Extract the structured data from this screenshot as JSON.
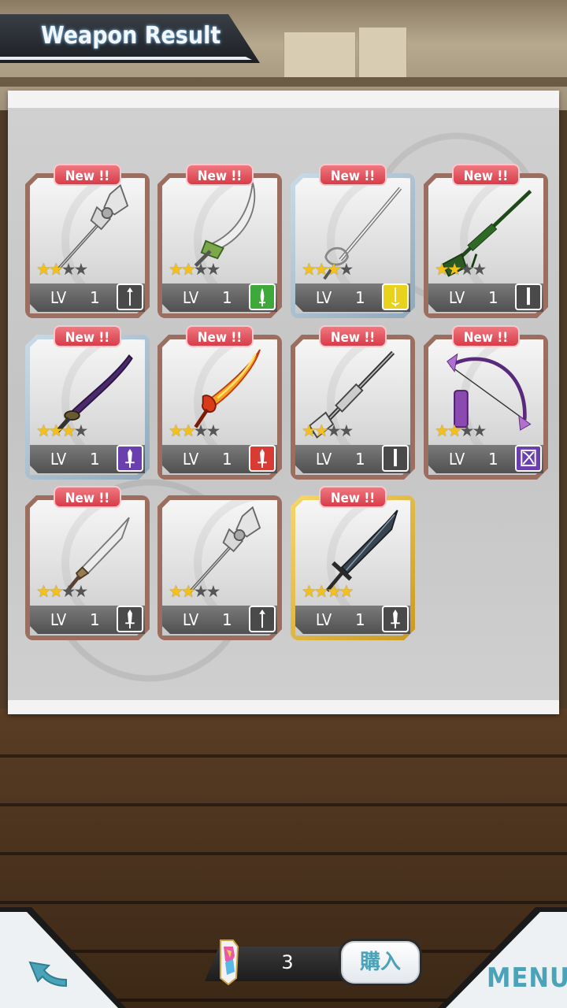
{
  "header": {
    "title": "Weapon Result"
  },
  "weapons": [
    {
      "badge": "New !!",
      "stars": 2,
      "lv_label": "LV",
      "level": "1",
      "frame": "bronze",
      "type": "spear",
      "type_color": "#4a4a4a",
      "art": "halberd-silver"
    },
    {
      "badge": "New !!",
      "stars": 2,
      "lv_label": "LV",
      "level": "1",
      "frame": "bronze",
      "type": "dagger",
      "type_color": "#3fa83a",
      "art": "scimitar-green"
    },
    {
      "badge": "New !!",
      "stars": 3,
      "lv_label": "LV",
      "level": "1",
      "frame": "silver",
      "type": "rapier",
      "type_color": "#e8d21e",
      "art": "rapier-silver"
    },
    {
      "badge": "New !!",
      "stars": 2,
      "lv_label": "LV",
      "level": "1",
      "frame": "bronze",
      "type": "gun",
      "type_color": "#4a4a4a",
      "art": "sniper-green"
    },
    {
      "badge": "New !!",
      "stars": 3,
      "lv_label": "LV",
      "level": "1",
      "frame": "silver",
      "type": "sword",
      "type_color": "#6a3fae",
      "art": "katana-purple"
    },
    {
      "badge": "New !!",
      "stars": 2,
      "lv_label": "LV",
      "level": "1",
      "frame": "bronze",
      "type": "sword",
      "type_color": "#d83a34",
      "art": "flame-sword"
    },
    {
      "badge": "New !!",
      "stars": 2,
      "lv_label": "LV",
      "level": "1",
      "frame": "bronze",
      "type": "gun",
      "type_color": "#4a4a4a",
      "art": "sniper-silver"
    },
    {
      "badge": "New !!",
      "stars": 2,
      "lv_label": "LV",
      "level": "1",
      "frame": "bronze",
      "type": "bow",
      "type_color": "#6a3fae",
      "art": "bow-purple"
    },
    {
      "badge": "New !!",
      "stars": 2,
      "lv_label": "LV",
      "level": "1",
      "frame": "bronze",
      "type": "sword",
      "type_color": "#4a4a4a",
      "art": "blade-silver"
    },
    {
      "badge": "",
      "stars": 2,
      "lv_label": "LV",
      "level": "1",
      "frame": "bronze",
      "type": "spear",
      "type_color": "#4a4a4a",
      "art": "halberd-silver"
    },
    {
      "badge": "New !!",
      "stars": 4,
      "lv_label": "LV",
      "level": "1",
      "frame": "gold",
      "type": "sword",
      "type_color": "#4a4a4a",
      "art": "longsword-dark"
    }
  ],
  "footer": {
    "back_icon": "back-arrow-icon",
    "currency_icon": "crystal-icon",
    "currency_count": "3",
    "buy_label": "購入",
    "menu_label": "MENU"
  },
  "colors": {
    "accent": "#4aa3b8",
    "new_badge": "#d63c48",
    "star": "#f4c01e"
  }
}
